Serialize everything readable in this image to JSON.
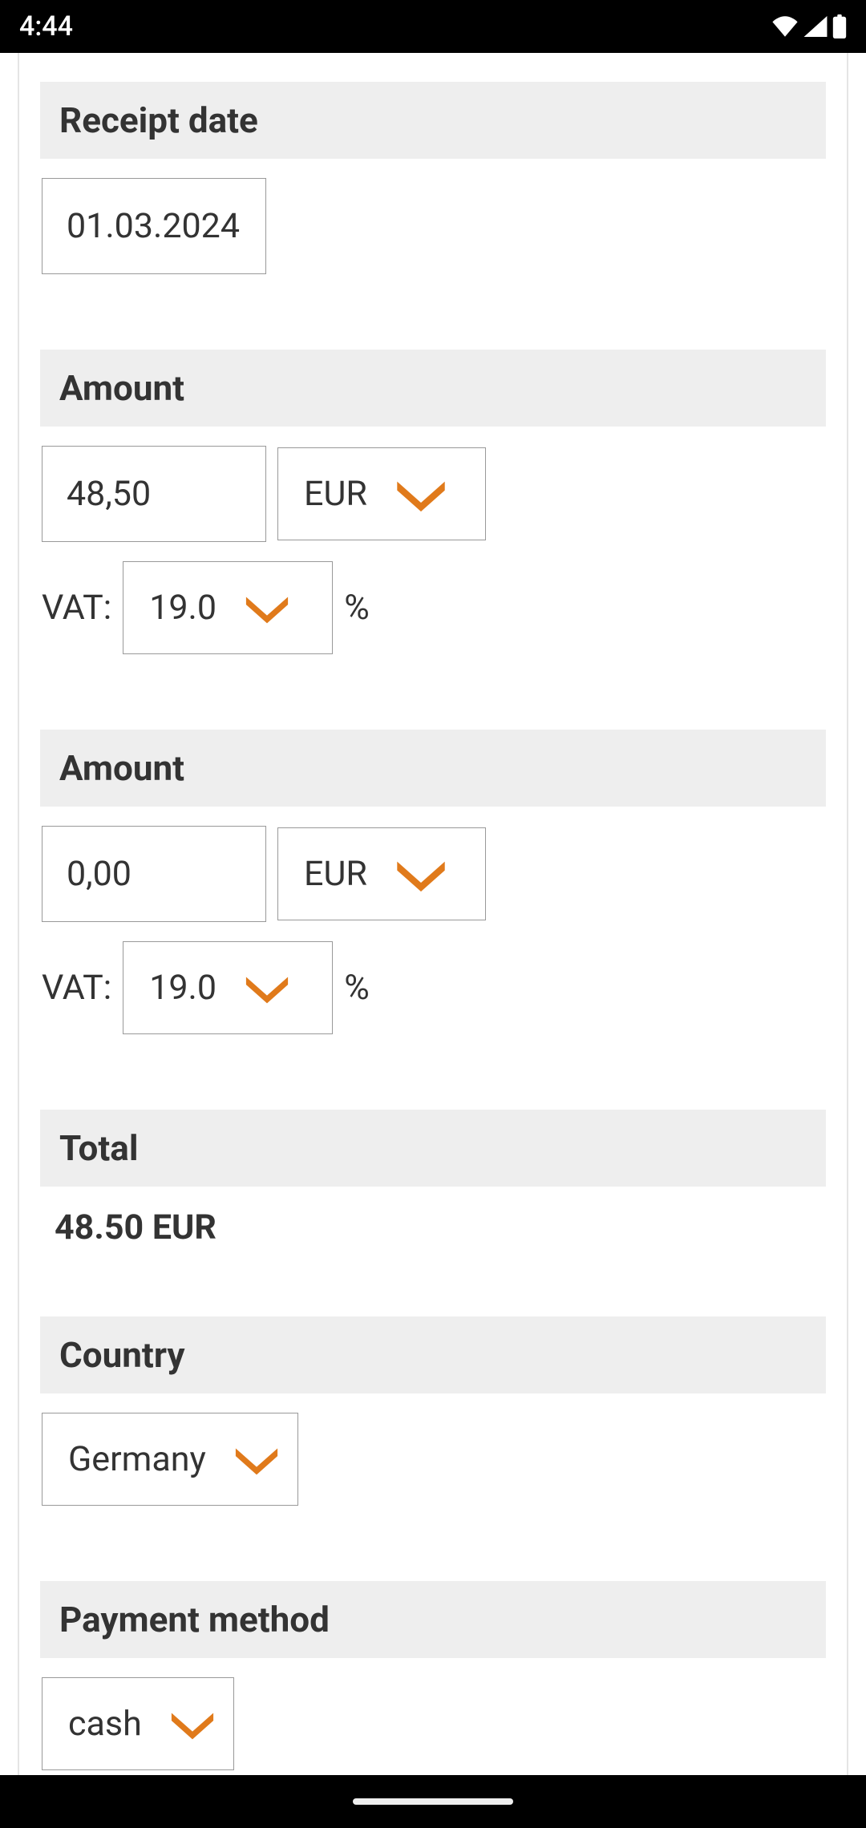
{
  "status": {
    "time": "4:44"
  },
  "sections": {
    "receiptDate": {
      "title": "Receipt date",
      "value": "01.03.2024"
    },
    "amount1": {
      "title": "Amount",
      "value": "48,50",
      "currency": "EUR",
      "vatLabel": "VAT:",
      "vatValue": "19.0",
      "percentLabel": "%"
    },
    "amount2": {
      "title": "Amount",
      "value": "0,00",
      "currency": "EUR",
      "vatLabel": "VAT:",
      "vatValue": "19.0",
      "percentLabel": "%"
    },
    "total": {
      "title": "Total",
      "value": "48.50 EUR"
    },
    "country": {
      "title": "Country",
      "value": "Germany"
    },
    "payment": {
      "title": "Payment method",
      "value": "cash"
    }
  },
  "colors": {
    "accent": "#e07a1b"
  }
}
